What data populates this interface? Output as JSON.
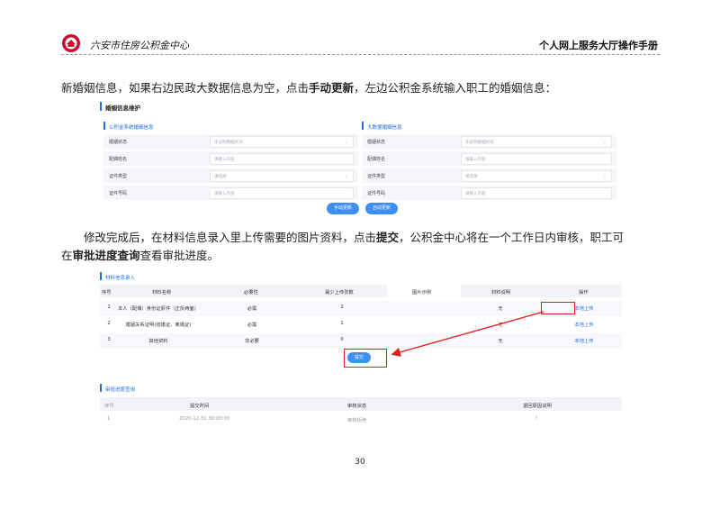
{
  "header": {
    "org": "六安市住房公积金中心",
    "title": "个人网上服务大厅操作手册"
  },
  "para1": {
    "a": "新婚姻信息，如果右边民政大数据信息为空，点击",
    "b": "手动更新",
    "c": "，左边公积金系统输入职工的婚姻信息："
  },
  "marriage": {
    "title": "婚姻信息维护",
    "left_title": "公积金系统婚姻信息",
    "right_title": "大数据婚姻信息",
    "rows": [
      {
        "label": "婚姻状态",
        "ph": "未说明婚姻状况",
        "dd": true
      },
      {
        "label": "配偶姓名",
        "ph": "请输入内容",
        "dd": false
      },
      {
        "label": "证件类型",
        "ph": "请选择",
        "dd": true
      },
      {
        "label": "证件号码",
        "ph": "请输入内容",
        "dd": false
      }
    ],
    "btn_manual": "手动更新",
    "btn_auto": "自动更新"
  },
  "para2": {
    "a": "修改完成后，在材料信息录入里上传需要的图片资料，点击",
    "b": "提交",
    "c": "，公积金中心将在一个工作日内审核，职工可",
    "d": "在",
    "e": "审批进度查询",
    "f": "查看审批进度。"
  },
  "materials": {
    "title": "材料信息录入",
    "headers": [
      "序号",
      "材料名称",
      "必要性",
      "最少上传张数",
      "图片示例",
      "材料说明",
      "操作"
    ],
    "rows": [
      {
        "no": "1",
        "name": "本人（配偶）身份证原件（正反两面）",
        "req": "必需",
        "min": "2",
        "note": "无",
        "op": "本地上传"
      },
      {
        "no": "2",
        "name": "婚姻关系证明(结婚证、离婚证)",
        "req": "必需",
        "min": "1",
        "note": "无",
        "op": "本地上传"
      },
      {
        "no": "3",
        "name": "其他资料",
        "req": "非必要",
        "min": "0",
        "note": "无",
        "op": "本地上传"
      }
    ],
    "submit": "提交"
  },
  "progress": {
    "title": "审批进度查询",
    "headers": [
      "序号",
      "提交时间",
      "审核状态",
      "退回原因说明"
    ],
    "row": {
      "no": "1",
      "time": "2020-12-31 00:00:00",
      "status": "审核拒绝",
      "reason": "?"
    }
  },
  "page_number": "30",
  "colors": {
    "accent": "#1f6fe0",
    "button": "#3d8ef5",
    "highlight": "#e21b1b",
    "logo": "#c8102e"
  }
}
